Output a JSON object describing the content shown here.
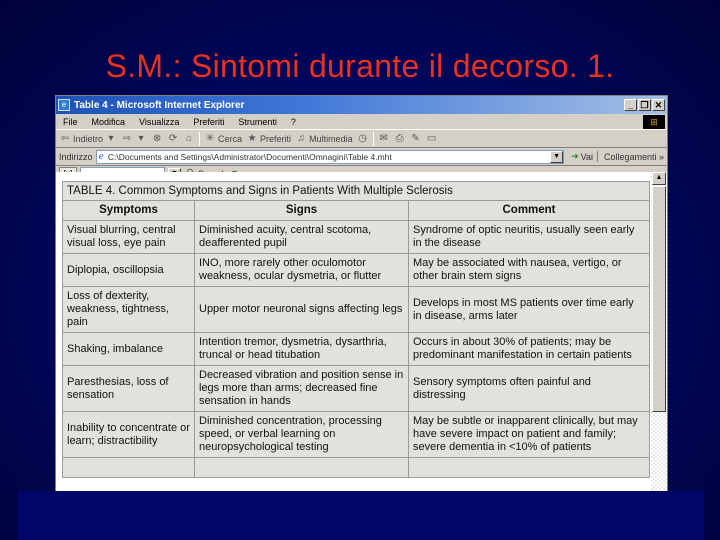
{
  "slide": {
    "title": "S.M.: Sintomi durante il decorso. 1."
  },
  "browser": {
    "window_title": "Table 4 - Microsoft Internet Explorer",
    "window_buttons": {
      "minimize": "_",
      "restore": "❐",
      "close": "✕"
    },
    "menu": [
      "File",
      "Modifica",
      "Visualizza",
      "Preferiti",
      "Strumenti",
      "?"
    ],
    "toolbar": {
      "back_label": "Indietro",
      "search_label": "Cerca",
      "favorites_label": "Preferiti",
      "multimedia_label": "Multimedia"
    },
    "address": {
      "label": "Indirizzo",
      "value": "C:\\Documents and Settings\\Administrator\\Documenti\\Omnagini\\Table 4.mht",
      "go_label": "Vai",
      "links_label": "Collegamenti »"
    },
    "searchbar": {
      "logo": "[x]",
      "search_label": "Search",
      "value": ""
    }
  },
  "table": {
    "caption": "TABLE 4. Common Symptoms and Signs in Patients With Multiple Sclerosis",
    "headers": [
      "Symptoms",
      "Signs",
      "Comment"
    ],
    "rows": [
      [
        "Visual blurring, central visual loss, eye pain",
        "Diminished acuity, central scotoma, deafferented pupil",
        "Syndrome of optic neuritis, usually seen early in the disease"
      ],
      [
        "Diplopia, oscillopsia",
        "INO, more rarely other oculomotor weakness, ocular dysmetria, or flutter",
        "May be associated with nausea, vertigo, or other brain stem signs"
      ],
      [
        "Loss of dexterity, weakness, tightness, pain",
        "Upper motor neuronal signs affecting legs",
        "Develops in most MS patients over time early in disease, arms later"
      ],
      [
        "Shaking, imbalance",
        "Intention tremor, dysmetria, dysarthria, truncal or head titubation",
        "Occurs in about 30% of patients; may be predominant manifestation in certain patients"
      ],
      [
        "Paresthesias, loss of sensation",
        "Decreased vibration and position sense in legs more than arms; decreased fine sensation in hands",
        "Sensory symptoms often painful and distressing"
      ],
      [
        "Inability to concentrate or learn; distractibility",
        "Diminished concentration, processing speed, or verbal learning on neuropsychological testing",
        "May be subtle or inapparent clinically, but may have severe impact on patient and family; severe dementia in <10% of patients"
      ]
    ]
  }
}
